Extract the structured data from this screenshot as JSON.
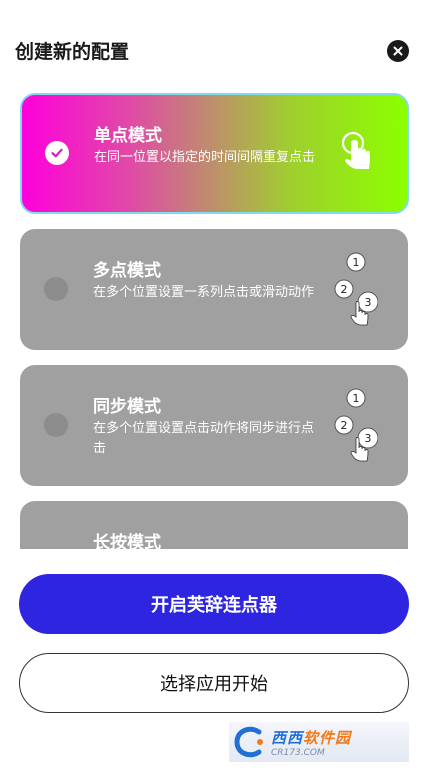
{
  "header": {
    "title": "创建新的配置",
    "close_icon": "close-icon"
  },
  "modes": [
    {
      "title": "单点模式",
      "desc": "在同一位置以指定的时间间隔重复点击",
      "selected": true,
      "icon": "single-tap-icon"
    },
    {
      "title": "多点模式",
      "desc": "在多个位置设置一系列点击或滑动动作",
      "selected": false,
      "icon": "multi-tap-icon",
      "step_numbers": [
        "1",
        "2",
        "3"
      ]
    },
    {
      "title": "同步模式",
      "desc": "在多个位置设置点击动作将同步进行点击",
      "selected": false,
      "icon": "sync-tap-icon",
      "step_numbers": [
        "1",
        "2",
        "3"
      ]
    },
    {
      "title": "长按模式",
      "desc": "",
      "selected": false,
      "icon": "long-press-icon"
    }
  ],
  "actions": {
    "primary_label": "开启芙辞连点器",
    "secondary_label": "选择应用开始"
  },
  "watermark": {
    "main_a": "西西",
    "main_b": "软件园",
    "sub": "CR173.COM"
  },
  "colors": {
    "primary": "#2d25e0",
    "card_gray": "#a0a0a0",
    "selected_gradient_start": "#ff00dc",
    "selected_gradient_end": "#8cff00",
    "selected_border": "#7fdcf0"
  }
}
